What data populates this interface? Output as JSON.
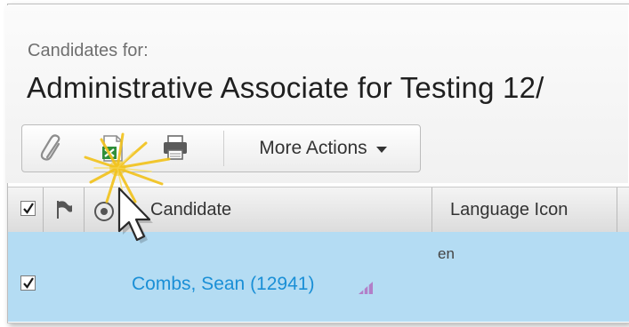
{
  "page": {
    "subtitle": "Candidates for:",
    "title": "Administrative Associate for Testing 12/"
  },
  "toolbar": {
    "icons": [
      "paperclip-icon",
      "excel-export-icon",
      "printer-icon"
    ],
    "more_actions_label": "More Actions"
  },
  "grid": {
    "columns": [
      "Candidate",
      "Language Icon"
    ],
    "header_checked": true,
    "rows": [
      {
        "checked": true,
        "candidate": "Combs, Sean (12941)",
        "language": "en"
      }
    ]
  },
  "colors": {
    "link": "#1a8fd6",
    "selected_row": "#b4dcf3",
    "rank_icon": "#b27fc8",
    "spark": "#f2c21a"
  }
}
